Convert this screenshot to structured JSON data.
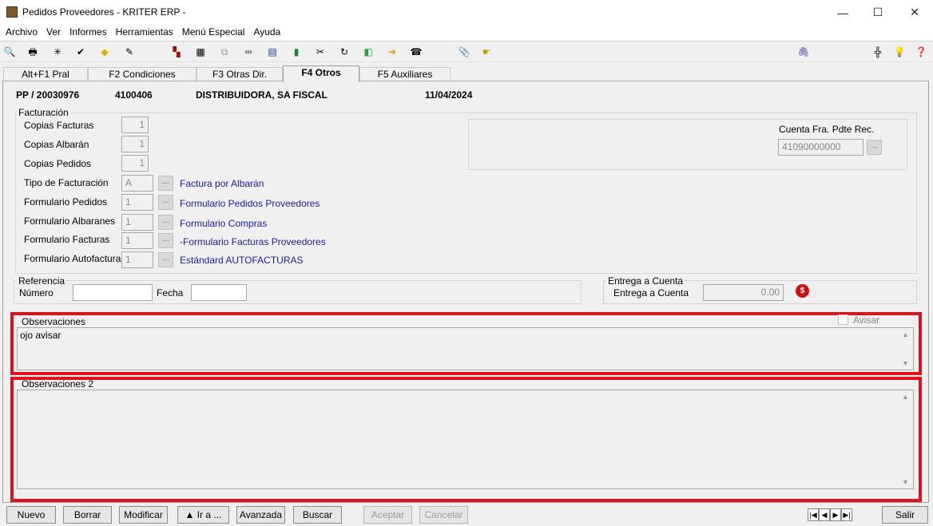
{
  "window": {
    "title": "Pedidos Proveedores - KRITER ERP -"
  },
  "menu": [
    "Archivo",
    "Ver",
    "Informes",
    "Herramientas",
    "Menú Especial",
    "Ayuda"
  ],
  "tabs": [
    "Alt+F1 Pral",
    "F2 Condiciones",
    "F3 Otras Dir.",
    "F4 Otros",
    "F5 Auxiliares"
  ],
  "active_tab": "F4 Otros",
  "header": {
    "doc": "PP / 20030976",
    "code": "4100406",
    "name": "DISTRIBUIDORA, SA FISCAL",
    "date": "11/04/2024"
  },
  "facturacion": {
    "title": "Facturación",
    "copias_facturas": {
      "label": "Copias Facturas",
      "value": "1"
    },
    "copias_albaran": {
      "label": "Copias Albarán",
      "value": "1"
    },
    "copias_pedidos": {
      "label": "Copias Pedidos",
      "value": "1"
    },
    "tipo": {
      "label": "Tipo de Facturación",
      "value": "A",
      "desc": "Factura por Albarán"
    },
    "form_pedidos": {
      "label": "Formulario Pedidos",
      "value": "1",
      "desc": "Formulario Pedidos Proveedores"
    },
    "form_albaranes": {
      "label": "Formulario Albaranes",
      "value": "1",
      "desc": "Formulario Compras"
    },
    "form_facturas": {
      "label": "Formulario Facturas",
      "value": "1",
      "desc": "-Formulario Facturas Proveedores"
    },
    "form_autofacturas": {
      "label": "Formulario Autofacturas",
      "value": "1",
      "desc": "Estándard AUTOFACTURAS"
    },
    "cuenta": {
      "label": "Cuenta Fra. Pdte Rec.",
      "value": "41090000000"
    }
  },
  "referencia": {
    "title": "Referencia",
    "numero_label": "Número",
    "numero": "",
    "fecha_label": "Fecha",
    "fecha": ""
  },
  "entrega": {
    "title": "Entrega a Cuenta",
    "label": "Entrega a Cuenta",
    "value": "0,00"
  },
  "observaciones": {
    "title": "Observaciones",
    "text": "ojo avisar",
    "avisar_label": "Avisar"
  },
  "observaciones2": {
    "title": "Observaciones 2",
    "text": ""
  },
  "buttons": {
    "nuevo": "Nuevo",
    "borrar": "Borrar",
    "modificar": "Modificar",
    "ira": "▲ Ir a ...",
    "avanzada": "Avanzada",
    "buscar": "Buscar",
    "aceptar": "Aceptar",
    "cancelar": "Cancelar",
    "salir": "Salir"
  },
  "nav": {
    "first": "|◀",
    "prev": "◀",
    "next": "▶",
    "last": "▶|"
  },
  "colors": {
    "highlight": "#e0101c",
    "link": "#1a1aa6"
  }
}
